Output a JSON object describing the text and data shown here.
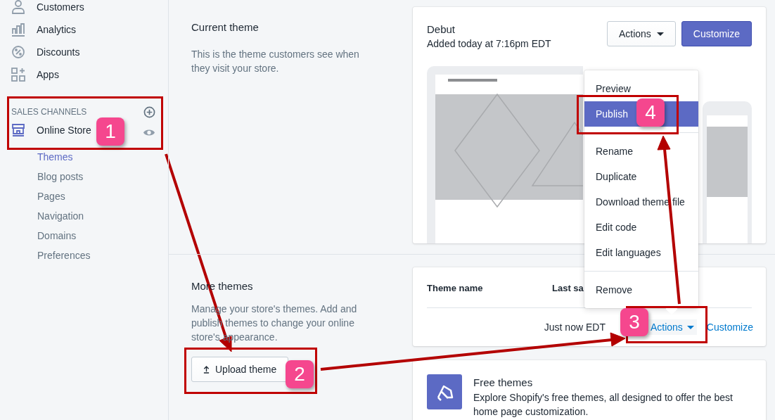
{
  "sidebar": {
    "items": [
      {
        "label": "Customers"
      },
      {
        "label": "Analytics"
      },
      {
        "label": "Discounts"
      },
      {
        "label": "Apps"
      }
    ],
    "sales_channels": {
      "heading": "SALES CHANNELS",
      "channel": "Online Store",
      "subitems": [
        {
          "label": "Themes",
          "selected": true
        },
        {
          "label": "Blog posts",
          "selected": false
        },
        {
          "label": "Pages",
          "selected": false
        },
        {
          "label": "Navigation",
          "selected": false
        },
        {
          "label": "Domains",
          "selected": false
        },
        {
          "label": "Preferences",
          "selected": false
        }
      ]
    }
  },
  "current_theme": {
    "title": "Current theme",
    "description": "This is the theme customers see when they visit your store.",
    "theme": {
      "name": "Debut",
      "added": "Added today at 7:16pm EDT",
      "actions_button": "Actions",
      "customize_button": "Customize"
    }
  },
  "actions_menu": {
    "groups": [
      [
        {
          "label": "Preview",
          "selected": false
        },
        {
          "label": "Publish",
          "selected": true
        }
      ],
      [
        {
          "label": "Rename",
          "selected": false
        },
        {
          "label": "Duplicate",
          "selected": false
        },
        {
          "label": "Download theme file",
          "selected": false
        },
        {
          "label": "Edit code",
          "selected": false
        },
        {
          "label": "Edit languages",
          "selected": false
        }
      ],
      [
        {
          "label": "Remove",
          "selected": false
        }
      ]
    ]
  },
  "more_themes": {
    "title": "More themes",
    "description": "Manage your store's themes. Add and publish themes to change your online store's appearance.",
    "upload_button": "Upload theme",
    "table": {
      "columns": [
        "Theme name",
        "Last sa"
      ],
      "rows": [
        {
          "last_saved": "Just now EDT",
          "actions": "Actions",
          "customize": "Customize"
        }
      ]
    }
  },
  "free_themes": {
    "title": "Free themes",
    "description": "Explore Shopify's free themes, all designed to offer the best home page customization."
  },
  "annotations": [
    {
      "label": "1"
    },
    {
      "label": "2"
    },
    {
      "label": "3"
    },
    {
      "label": "4"
    }
  ]
}
